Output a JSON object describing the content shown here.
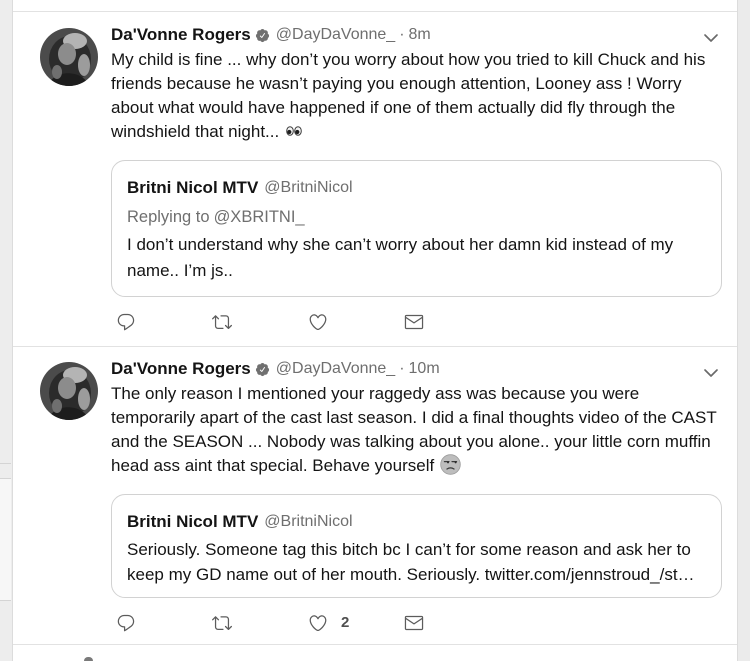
{
  "colors": {
    "text": "#141414",
    "muted": "#6f6f6f",
    "icon": "#5c5c5c",
    "divider": "#e2e2e2",
    "card_border": "#d2d2d2",
    "page_bg": "#ebebeb"
  },
  "tweets": [
    {
      "author": {
        "name": "Da'Vonne Rogers",
        "handle": "@DayDaVonne_",
        "verified": true
      },
      "separator": "·",
      "time": "8m",
      "menu_icon": "chevron-down-icon",
      "text_lines": [
        "My child is fine ... why don’t you worry about how you tried to kill Chuck and his",
        "friends because he wasn’t paying you enough attention, Looney ass ! Worry",
        "about what would have happened if one of them actually did fly through the",
        "windshield that night..."
      ],
      "trailing_emoji": "eyes-emoji",
      "quote": {
        "name": "Britni Nicol MTV",
        "handle": "@BritniNicol",
        "replying_label": "Replying to",
        "replying_handle": "@XBRITNI_",
        "text_lines": [
          "I don’t understand why she can’t worry about her damn kid instead of my",
          "name.. I’m js.."
        ]
      },
      "actions": {
        "reply_icon": "reply-icon",
        "retweet_icon": "retweet-icon",
        "like_icon": "heart-icon",
        "message_icon": "envelope-icon"
      }
    },
    {
      "author": {
        "name": "Da'Vonne Rogers",
        "handle": "@DayDaVonne_",
        "verified": true
      },
      "separator": "·",
      "time": "10m",
      "menu_icon": "chevron-down-icon",
      "text_lines": [
        "The only reason I mentioned your raggedy ass was because you were",
        "temporarily apart of the cast last season. I did a final thoughts video of the CAST",
        "and the SEASON ... Nobody was talking about you alone.. your little corn muffin",
        "head ass aint that special. Behave yourself"
      ],
      "trailing_emoji": "unamused-face-emoji",
      "quote": {
        "name": "Britni Nicol MTV",
        "handle": "@BritniNicol",
        "text_lines": [
          "Seriously. Someone tag this bitch bc I can’t for some reason and ask her to",
          "keep my GD name out of her mouth. Seriously. twitter.com/jennstroud_/st…"
        ]
      },
      "actions": {
        "reply_icon": "reply-icon",
        "retweet_icon": "retweet-icon",
        "like_icon": "heart-icon",
        "like_count": "2",
        "message_icon": "envelope-icon"
      }
    }
  ]
}
